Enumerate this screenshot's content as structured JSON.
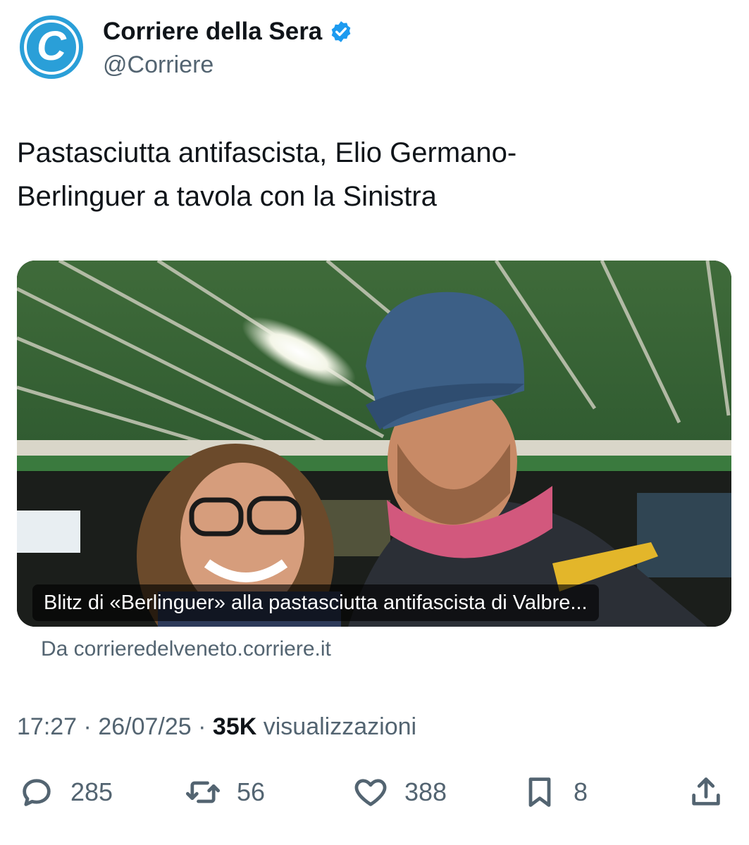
{
  "account": {
    "display_name": "Corriere della Sera",
    "handle": "@Corriere",
    "avatar_letter": "C",
    "avatar_color": "#2a9fd8",
    "verified_color": "#1d9bf0"
  },
  "tweet": {
    "text_line1": "Pastasciutta antifascista, Elio Germano-",
    "text_line2": "Berlinguer a tavola con la Sinistra"
  },
  "card": {
    "caption": "Blitz di «Berlinguer» alla pastasciutta antifascista di Valbre...",
    "source": "Da corrieredelveneto.corriere.it"
  },
  "meta": {
    "time": "17:27",
    "separator": "·",
    "date": "26/07/25",
    "views_count": "35K",
    "views_label": "visualizzazioni"
  },
  "actions": {
    "replies": "285",
    "reposts": "56",
    "likes": "388",
    "bookmarks": "8"
  },
  "icons": {
    "reply": "reply-bubble-icon",
    "repost": "repost-icon",
    "like": "heart-icon",
    "bookmark": "bookmark-icon",
    "share": "share-icon",
    "verified": "verified-badge-icon"
  }
}
